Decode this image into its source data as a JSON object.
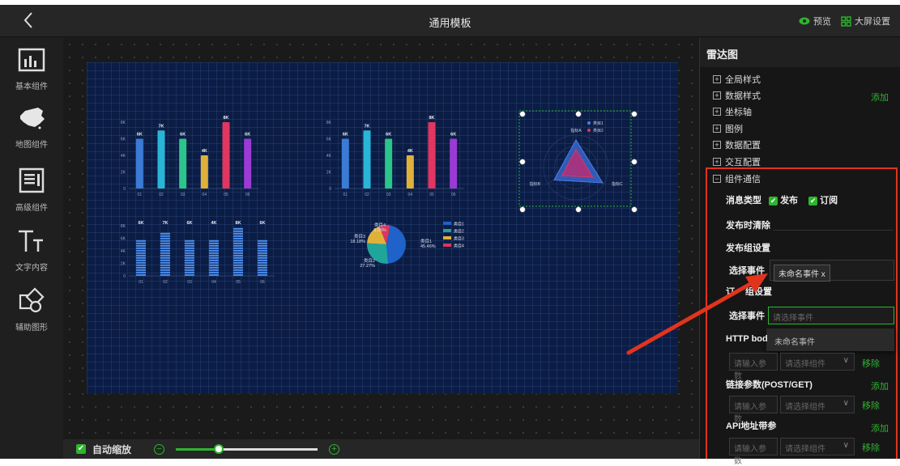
{
  "header": {
    "title": "通用模板",
    "preview_label": "预览",
    "settings_label": "大屏设置"
  },
  "sidebar": {
    "items": [
      {
        "label": "基本组件",
        "icon": "bar-chart-icon"
      },
      {
        "label": "地图组件",
        "icon": "china-map-icon"
      },
      {
        "label": "高级组件",
        "icon": "advanced-panel-icon"
      },
      {
        "label": "文字内容",
        "icon": "text-icon"
      },
      {
        "label": "辅助图形",
        "icon": "shapes-icon"
      }
    ]
  },
  "footer": {
    "autoscale_label": "自动缩放",
    "zoom_minus": "−",
    "zoom_plus": "+",
    "zoom_level": 0.3
  },
  "panel": {
    "title": "雷达图",
    "sections": [
      "全局样式",
      "数据样式",
      "坐标轴",
      "图例",
      "数据配置",
      "交互配置",
      "组件通信"
    ],
    "add_label": "添加",
    "msg_type_label": "消息类型",
    "publish_label": "发布",
    "subscribe_label": "订阅",
    "clear_on_publish_label": "发布时清除",
    "publish_group_label": "发布组设置",
    "select_event_label": "选择事件",
    "event_tag": "未命名事件",
    "tag_close": "x",
    "subscribe_group_label_a": "订",
    "subscribe_group_label_b": "组设置",
    "select_event_label_2": "选择事件",
    "select_event_placeholder": "请选择事件",
    "dropdown_option": "未命名事件",
    "http_body_label": "HTTP bod",
    "param_placeholder": "请输入参数",
    "component_placeholder": "请选择组件",
    "remove_label": "移除",
    "link_params_label": "链接参数(POST/GET)",
    "api_params_label": "API地址带参"
  },
  "colors": {
    "accent": "#2db52d",
    "highlight": "#e2341d",
    "canvas": "#0c1d45"
  },
  "chart_data": [
    {
      "type": "bar",
      "categories": [
        "01",
        "02",
        "03",
        "04",
        "05",
        "06"
      ],
      "values": [
        6,
        7,
        6,
        4,
        8,
        6
      ],
      "value_labels": [
        "6K",
        "7K",
        "6K",
        "4K",
        "8K",
        "6K"
      ],
      "y_ticks": [
        "0",
        "2K",
        "4K",
        "6K",
        "8K"
      ],
      "ylim": [
        0,
        8
      ]
    },
    {
      "type": "bar",
      "categories": [
        "01",
        "02",
        "03",
        "04",
        "05",
        "06"
      ],
      "values": [
        6,
        7,
        6,
        4,
        8,
        6
      ],
      "value_labels": [
        "6K",
        "7K",
        "6K",
        "4K",
        "8K",
        "6K"
      ],
      "y_ticks": [
        "0",
        "2K",
        "4K",
        "6K",
        "8K"
      ],
      "ylim": [
        0,
        8
      ]
    },
    {
      "type": "bar",
      "categories": [
        "01",
        "02",
        "03",
        "04",
        "05",
        "06"
      ],
      "values": [
        6,
        7,
        6,
        6,
        8,
        6
      ],
      "value_labels": [
        "6K",
        "7K",
        "6K",
        "4K",
        "8K",
        "6K"
      ],
      "y_ticks": [
        "0",
        "2K",
        "4K",
        "6K",
        "8K"
      ],
      "ylim": [
        0,
        8
      ]
    },
    {
      "type": "pie",
      "labels": [
        "类目1",
        "类目2",
        "类目3",
        "类目4"
      ],
      "values": [
        45.46,
        27.27,
        18.18,
        9.09
      ],
      "value_labels": [
        "45.46%",
        "27.27%",
        "18.18%",
        "9.09%"
      ]
    },
    {
      "type": "radar",
      "indicators": [
        "指标A",
        "指标B",
        "指标C"
      ],
      "legend": [
        "类目1",
        "类目2"
      ]
    }
  ]
}
